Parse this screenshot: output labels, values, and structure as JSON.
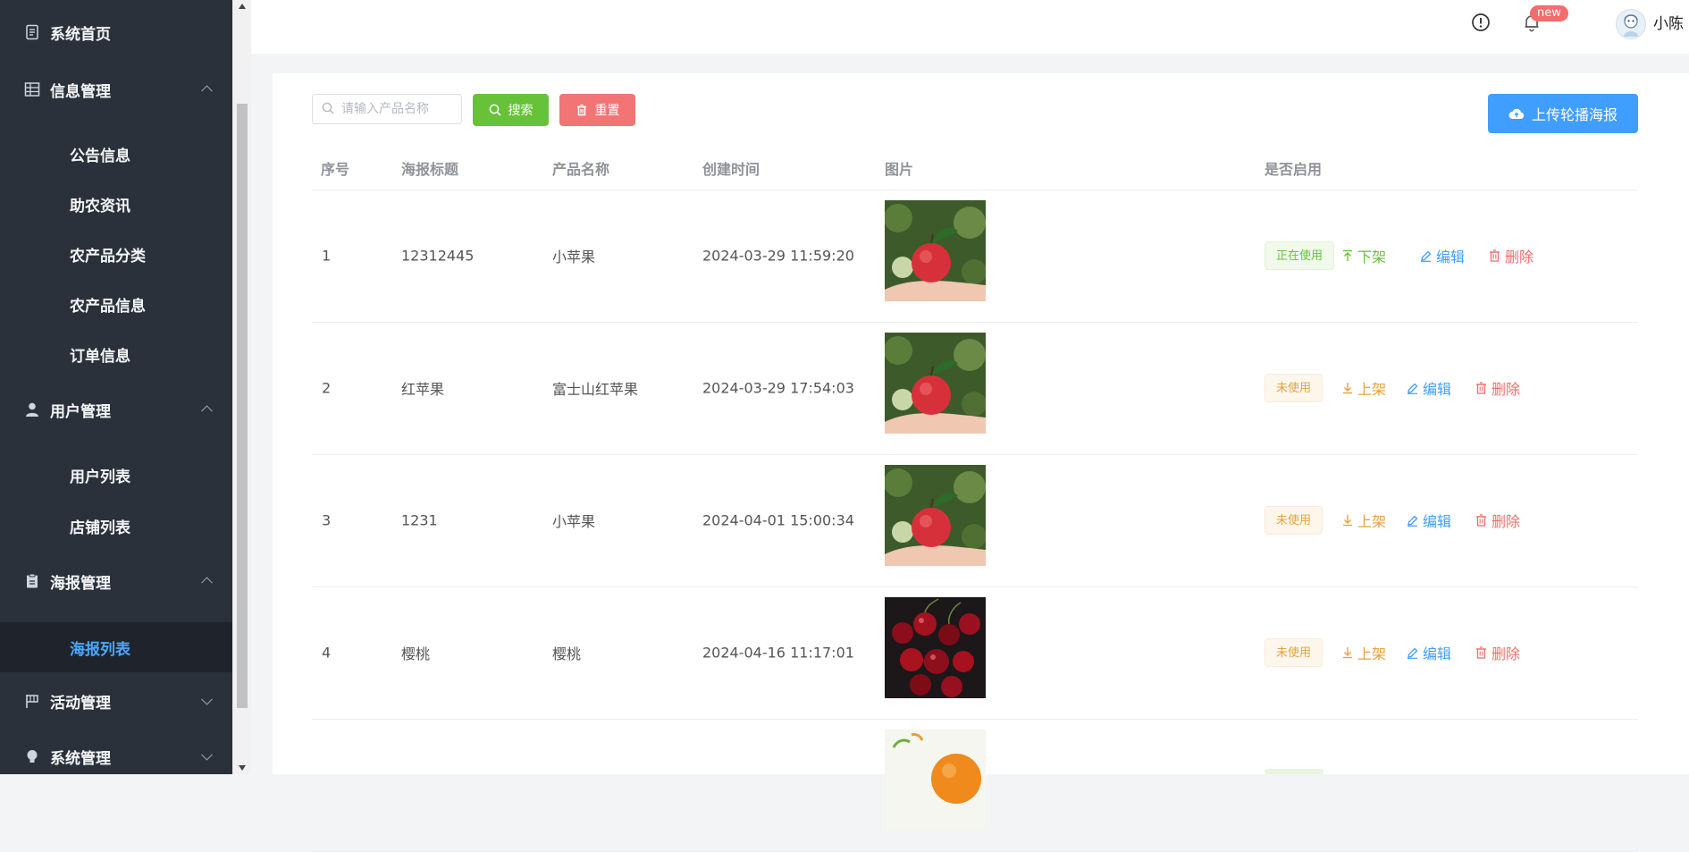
{
  "sidebar": {
    "items": [
      {
        "label": "系统首页",
        "icon": "document-icon"
      },
      {
        "label": "信息管理",
        "icon": "grid-icon"
      },
      {
        "label": "公告信息"
      },
      {
        "label": "助农资讯"
      },
      {
        "label": "农产品分类"
      },
      {
        "label": "农产品信息"
      },
      {
        "label": "订单信息"
      },
      {
        "label": "用户管理",
        "icon": "user-icon"
      },
      {
        "label": "用户列表"
      },
      {
        "label": "店铺列表"
      },
      {
        "label": "海报管理",
        "icon": "clipboard-icon"
      },
      {
        "label": "海报列表"
      },
      {
        "label": "活动管理",
        "icon": "flag-icon"
      },
      {
        "label": "系统管理",
        "icon": "lightbulb-icon"
      }
    ]
  },
  "header": {
    "badge": "new",
    "username": "小陈"
  },
  "toolbar": {
    "search_placeholder": "请输入产品名称",
    "search_label": "搜索",
    "reset_label": "重置",
    "upload_label": "上传轮播海报"
  },
  "table": {
    "headers": [
      "序号",
      "海报标题",
      "产品名称",
      "创建时间",
      "图片",
      "是否启用"
    ],
    "rows": [
      {
        "index": "1",
        "title": "12312445",
        "product": "小苹果",
        "created": "2024-03-29 11:59:20",
        "image": "apple",
        "status": "正在使用",
        "toggle": "下架",
        "edit": "编辑",
        "delete": "删除"
      },
      {
        "index": "2",
        "title": "红苹果",
        "product": "富士山红苹果",
        "created": "2024-03-29 17:54:03",
        "image": "apple",
        "status": "未使用",
        "toggle": "上架",
        "edit": "编辑",
        "delete": "删除"
      },
      {
        "index": "3",
        "title": "1231",
        "product": "小苹果",
        "created": "2024-04-01 15:00:34",
        "image": "apple",
        "status": "未使用",
        "toggle": "上架",
        "edit": "编辑",
        "delete": "删除"
      },
      {
        "index": "4",
        "title": "樱桃",
        "product": "樱桃",
        "created": "2024-04-16 11:17:01",
        "image": "cherry",
        "status": "未使用",
        "toggle": "上架",
        "edit": "编辑",
        "delete": "删除"
      }
    ]
  },
  "colors": {
    "sidebar_bg": "#2b313b",
    "active_text": "#4aa7ff",
    "primary": "#409eff",
    "success": "#67c23a",
    "warning": "#e6a23c",
    "danger": "#f56c6c"
  }
}
